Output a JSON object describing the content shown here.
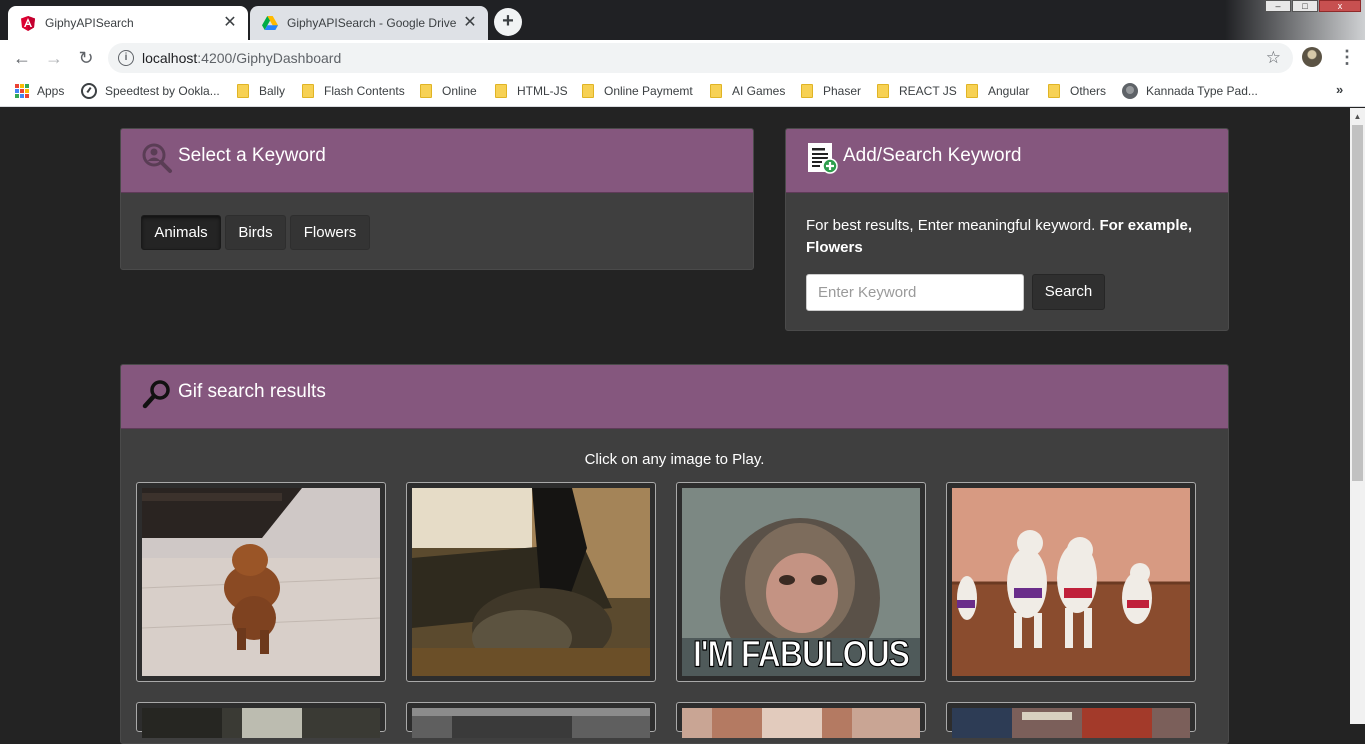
{
  "browser": {
    "tabs": [
      {
        "title": "GiphyAPISearch",
        "icon": "angular-icon",
        "active": true
      },
      {
        "title": "GiphyAPISearch - Google Drive",
        "icon": "google-drive-icon",
        "active": false
      }
    ],
    "close_glyph": "✕",
    "new_tab_glyph": "+",
    "address": {
      "host": "localhost",
      "path": ":4200/GiphyDashboard"
    },
    "bookmarks": [
      {
        "label": "Apps",
        "icon": "apps-grid-icon"
      },
      {
        "label": "Speedtest by Ookla...",
        "icon": "speedtest-icon"
      },
      {
        "label": "Bally",
        "icon": "folder-icon"
      },
      {
        "label": "Flash Contents",
        "icon": "folder-icon"
      },
      {
        "label": "Online",
        "icon": "folder-icon"
      },
      {
        "label": "HTML-JS",
        "icon": "folder-icon"
      },
      {
        "label": "Online Paymemt",
        "icon": "folder-icon"
      },
      {
        "label": "AI Games",
        "icon": "folder-icon"
      },
      {
        "label": "Phaser",
        "icon": "folder-icon"
      },
      {
        "label": "REACT JS",
        "icon": "folder-icon"
      },
      {
        "label": "Angular",
        "icon": "folder-icon"
      },
      {
        "label": "Others",
        "icon": "folder-icon"
      },
      {
        "label": "Kannada Type Pad...",
        "icon": "globe-icon"
      }
    ],
    "more_glyph": "»"
  },
  "select_panel": {
    "title": "Select a Keyword",
    "icon": "magnifier-person-icon",
    "keywords": [
      {
        "label": "Animals",
        "active": true
      },
      {
        "label": "Birds",
        "active": false
      },
      {
        "label": "Flowers",
        "active": false
      }
    ]
  },
  "add_panel": {
    "title": "Add/Search Keyword",
    "icon": "add-document-icon",
    "hint_text": "For best results, Enter meaningful keyword.",
    "hint_bold": "For example, Flowers",
    "input": {
      "placeholder": "Enter Keyword",
      "value": ""
    },
    "search_label": "Search"
  },
  "results_panel": {
    "title": "Gif search results",
    "icon": "magnifying-glass-icon",
    "play_hint": "Click on any image to Play.",
    "gifs": [
      {
        "name": "poodle-walking-gif"
      },
      {
        "name": "cat-dancing-gif"
      },
      {
        "name": "monkey-fabulous-gif",
        "caption": "I'M FABULOUS"
      },
      {
        "name": "dancing-poodles-gif"
      },
      {
        "name": "gif-result-5"
      },
      {
        "name": "gif-result-6"
      },
      {
        "name": "gif-result-7"
      },
      {
        "name": "gif-result-8"
      }
    ]
  },
  "colors": {
    "page_bg": "#232323",
    "panel_bg": "#3f3f3f",
    "panel_header": "#85577e",
    "button_dark": "#343434"
  }
}
